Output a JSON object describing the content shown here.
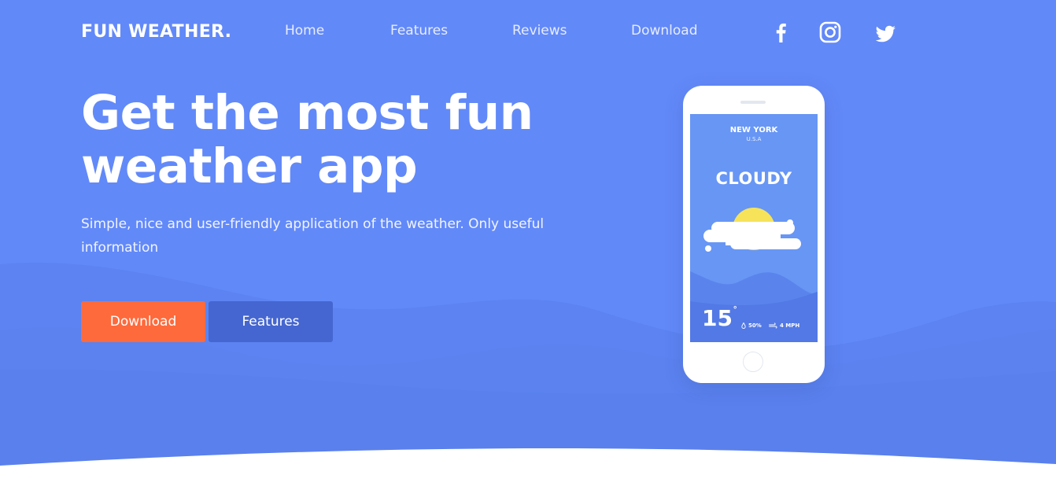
{
  "header": {
    "logo": "FUN WEATHER.",
    "nav": [
      {
        "label": "Home"
      },
      {
        "label": "Features"
      },
      {
        "label": "Reviews"
      },
      {
        "label": "Download"
      }
    ],
    "social": [
      "facebook-icon",
      "instagram-icon",
      "twitter-icon"
    ]
  },
  "hero": {
    "title_line1": "Get the most fun",
    "title_line2": "weather app",
    "subtitle_line1": "Simple, nice and user-friendly application of the weather. Only useful",
    "subtitle_line2": "information",
    "primary_button": "Download",
    "secondary_button": "Features"
  },
  "phone_screen": {
    "city": "NEW YORK",
    "country": "U.S.A",
    "condition": "CLOUDY",
    "temperature": "15",
    "degree_symbol": "°",
    "humidity": "50%",
    "wind": "4 MPH",
    "icons": [
      "sun-icon",
      "cloud-icon",
      "droplet-icon",
      "wind-icon"
    ]
  },
  "colors": {
    "background": "#6289f8",
    "accent_orange": "#fe6a3c",
    "button_blue": "#4566d0",
    "sun_yellow": "#f6e35a"
  }
}
